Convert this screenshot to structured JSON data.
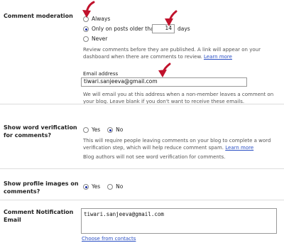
{
  "comment_moderation": {
    "label": "Comment moderation",
    "options": [
      "Always",
      "Only on posts older than",
      "Never"
    ],
    "days_value": "14",
    "days_suffix": "days",
    "help_text": "Review comments before they are published. A link will appear on your dashboard when there are comments to review.",
    "learn_more": "Learn more",
    "email_label": "Email address",
    "email_value": "tiwari.sanjeeva@gmail.com",
    "email_help": "We will email you at this address when a non-member leaves a comment on your blog. Leave blank if you don't want to receive these emails."
  },
  "word_verification": {
    "label_line1": "Show word verification",
    "label_line2": "for comments?",
    "yes": "Yes",
    "no": "No",
    "help_text": "This will require people leaving comments on your blog to complete a word verification step, which will help reduce comment spam.",
    "learn_more": "Learn more",
    "note": "Blog authors will not see word verification for comments."
  },
  "profile_images": {
    "label_line1": "Show profile images on",
    "label_line2": "comments?",
    "yes": "Yes",
    "no": "No"
  },
  "notification_email": {
    "label_line1": "Comment Notification",
    "label_line2": "Email",
    "value": "tiwari.sanjeeva@gmail.com",
    "choose_link": "Choose from contacts"
  },
  "annotation_arrow_color": "#c0122c"
}
